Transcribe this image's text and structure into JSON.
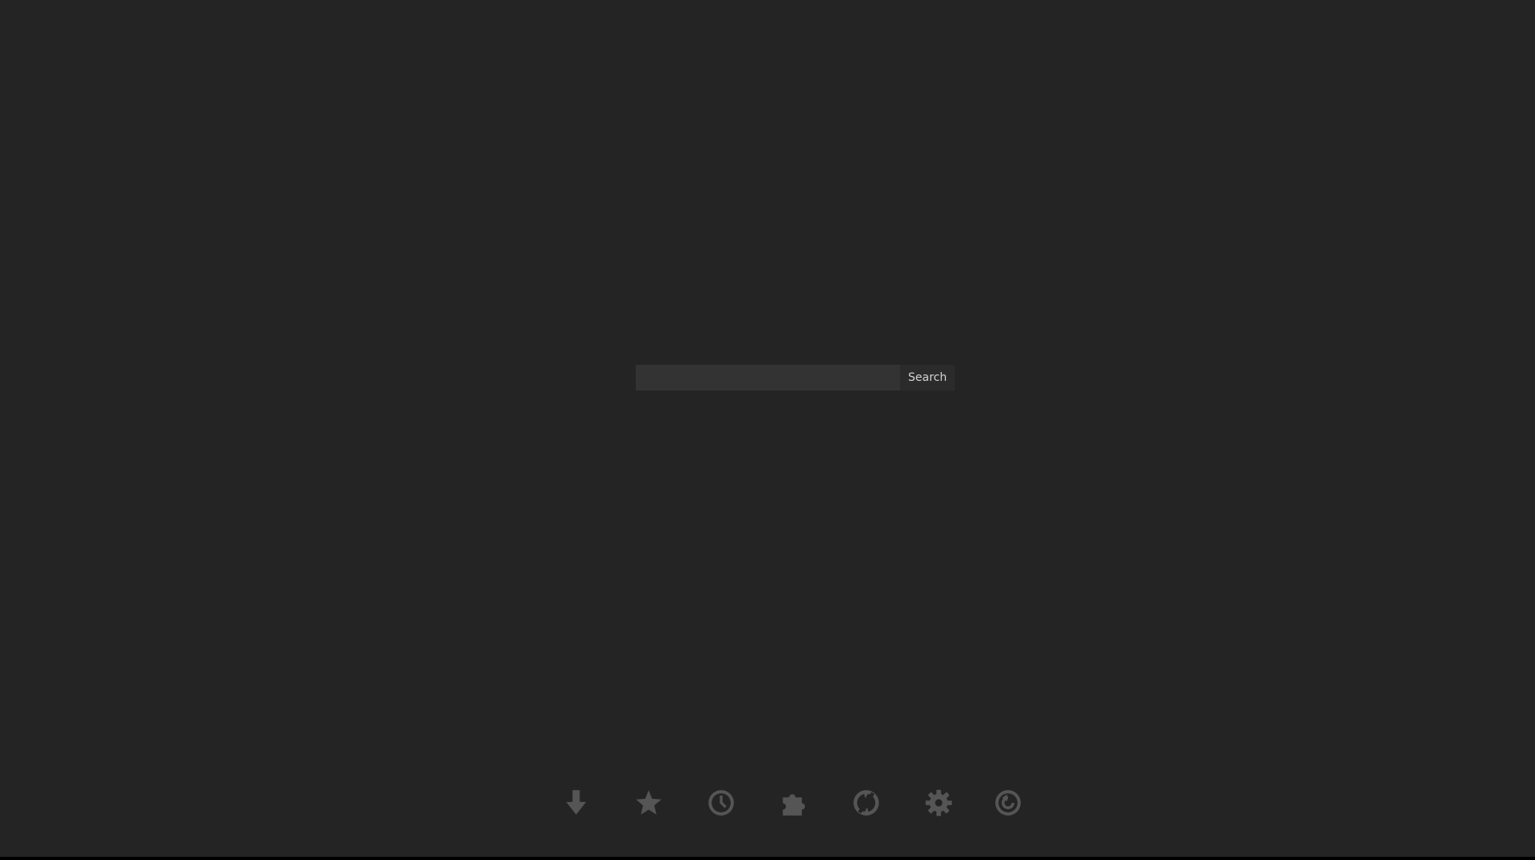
{
  "search": {
    "query": "",
    "placeholder": "",
    "button_label": "Search"
  },
  "toolbar": {
    "icon_color": "#555555",
    "items": [
      {
        "icon": "download-arrow-icon"
      },
      {
        "icon": "star-icon"
      },
      {
        "icon": "clock-icon"
      },
      {
        "icon": "puzzle-piece-icon"
      },
      {
        "icon": "sync-icon"
      },
      {
        "icon": "gear-icon"
      },
      {
        "icon": "restore-icon"
      }
    ]
  },
  "theme": {
    "background": "#242424",
    "input_background": "#333333",
    "button_background": "#2b2b2b",
    "button_text": "#d4d4d4"
  }
}
